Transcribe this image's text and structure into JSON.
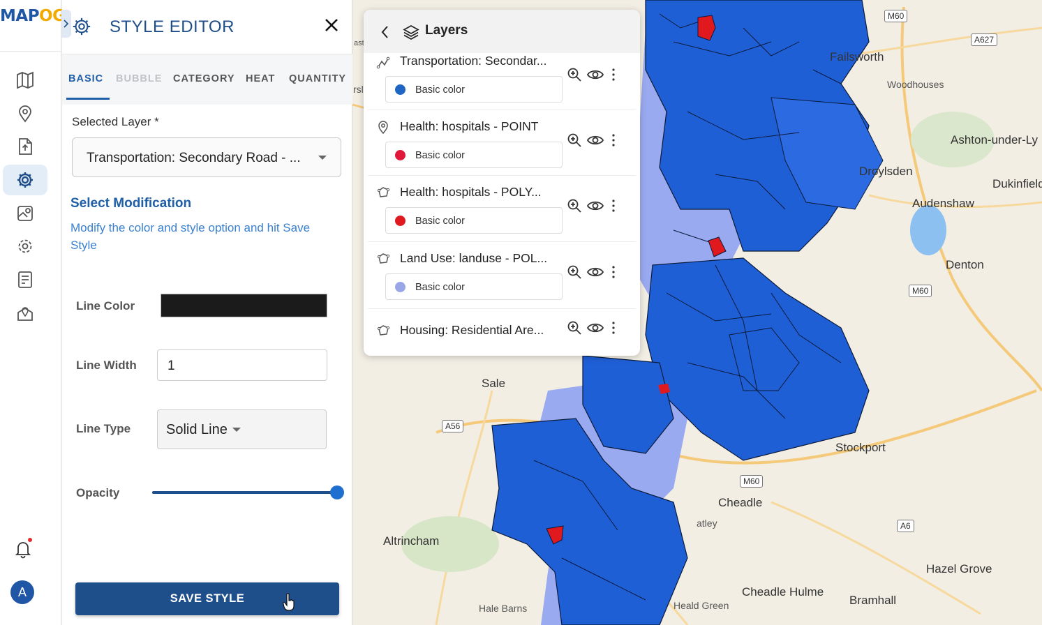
{
  "app": {
    "logo_main": "MAP",
    "logo_accent": "OG"
  },
  "sidebar": {
    "items": [
      {
        "icon": "map-icon"
      },
      {
        "icon": "location-pin-icon"
      },
      {
        "icon": "upload-file-icon"
      },
      {
        "icon": "style-gear-icon",
        "active": true
      },
      {
        "icon": "analysis-map-icon"
      },
      {
        "icon": "settings-icon"
      },
      {
        "icon": "report-icon"
      },
      {
        "icon": "share-map-icon"
      }
    ],
    "notification_icon": "bell-icon",
    "avatar_initial": "A"
  },
  "style_editor": {
    "title": "STYLE EDITOR",
    "tabs": [
      {
        "label": "BASIC",
        "state": "active"
      },
      {
        "label": "BUBBLE",
        "state": "disabled"
      },
      {
        "label": "CATEGORY",
        "state": "normal"
      },
      {
        "label": "HEAT",
        "state": "normal"
      },
      {
        "label": "QUANTITY",
        "state": "normal"
      }
    ],
    "selected_layer_label": "Selected Layer *",
    "selected_layer_value": "Transportation: Secondary Road - ...",
    "section_title": "Select Modification",
    "section_desc": "Modify the color and style option and hit Save Style",
    "line_color_label": "Line Color",
    "line_color_value": "#1b1b1b",
    "line_width_label": "Line Width",
    "line_width_value": "1",
    "line_type_label": "Line Type",
    "line_type_value": "Solid Line",
    "opacity_label": "Opacity",
    "opacity_value": 1.0,
    "save_label": "SAVE STYLE"
  },
  "layers_panel": {
    "title": "Layers",
    "items": [
      {
        "name": "Transportation: Secondar...",
        "type_icon": "line-icon",
        "color_label": "Basic color",
        "color": "#1f66c4"
      },
      {
        "name": "Health: hospitals - POINT",
        "type_icon": "point-icon",
        "color_label": "Basic color",
        "color": "#e0193a"
      },
      {
        "name": "Health: hospitals - POLY...",
        "type_icon": "polygon-icon",
        "color_label": "Basic color",
        "color": "#e0191f"
      },
      {
        "name": "Land Use: landuse - POL...",
        "type_icon": "polygon-icon",
        "color_label": "Basic color",
        "color": "#9aa7e6"
      },
      {
        "name": "Housing: Residential Are...",
        "type_icon": "polygon-icon"
      }
    ]
  },
  "map": {
    "places": [
      "Failsworth",
      "Woodhouses",
      "Ashton-under-Ly",
      "Droylsden",
      "Dukinfield",
      "Audenshaw",
      "Denton",
      "Sale",
      "Stockport",
      "Cheadle",
      "Altrincham",
      "Hazel Grove",
      "Cheadle Hulme",
      "Bramhall",
      "Hale Barns",
      "Heald Green",
      "atley",
      "ast",
      "rsl"
    ],
    "road_shields": [
      "M60",
      "A627",
      "M60",
      "A56",
      "M60",
      "A6",
      "M60"
    ],
    "colors": {
      "polygon_fill": "#1f5fd6",
      "landuse_fill": "#9aaaf0",
      "hospital_fill": "#e0191f"
    }
  }
}
